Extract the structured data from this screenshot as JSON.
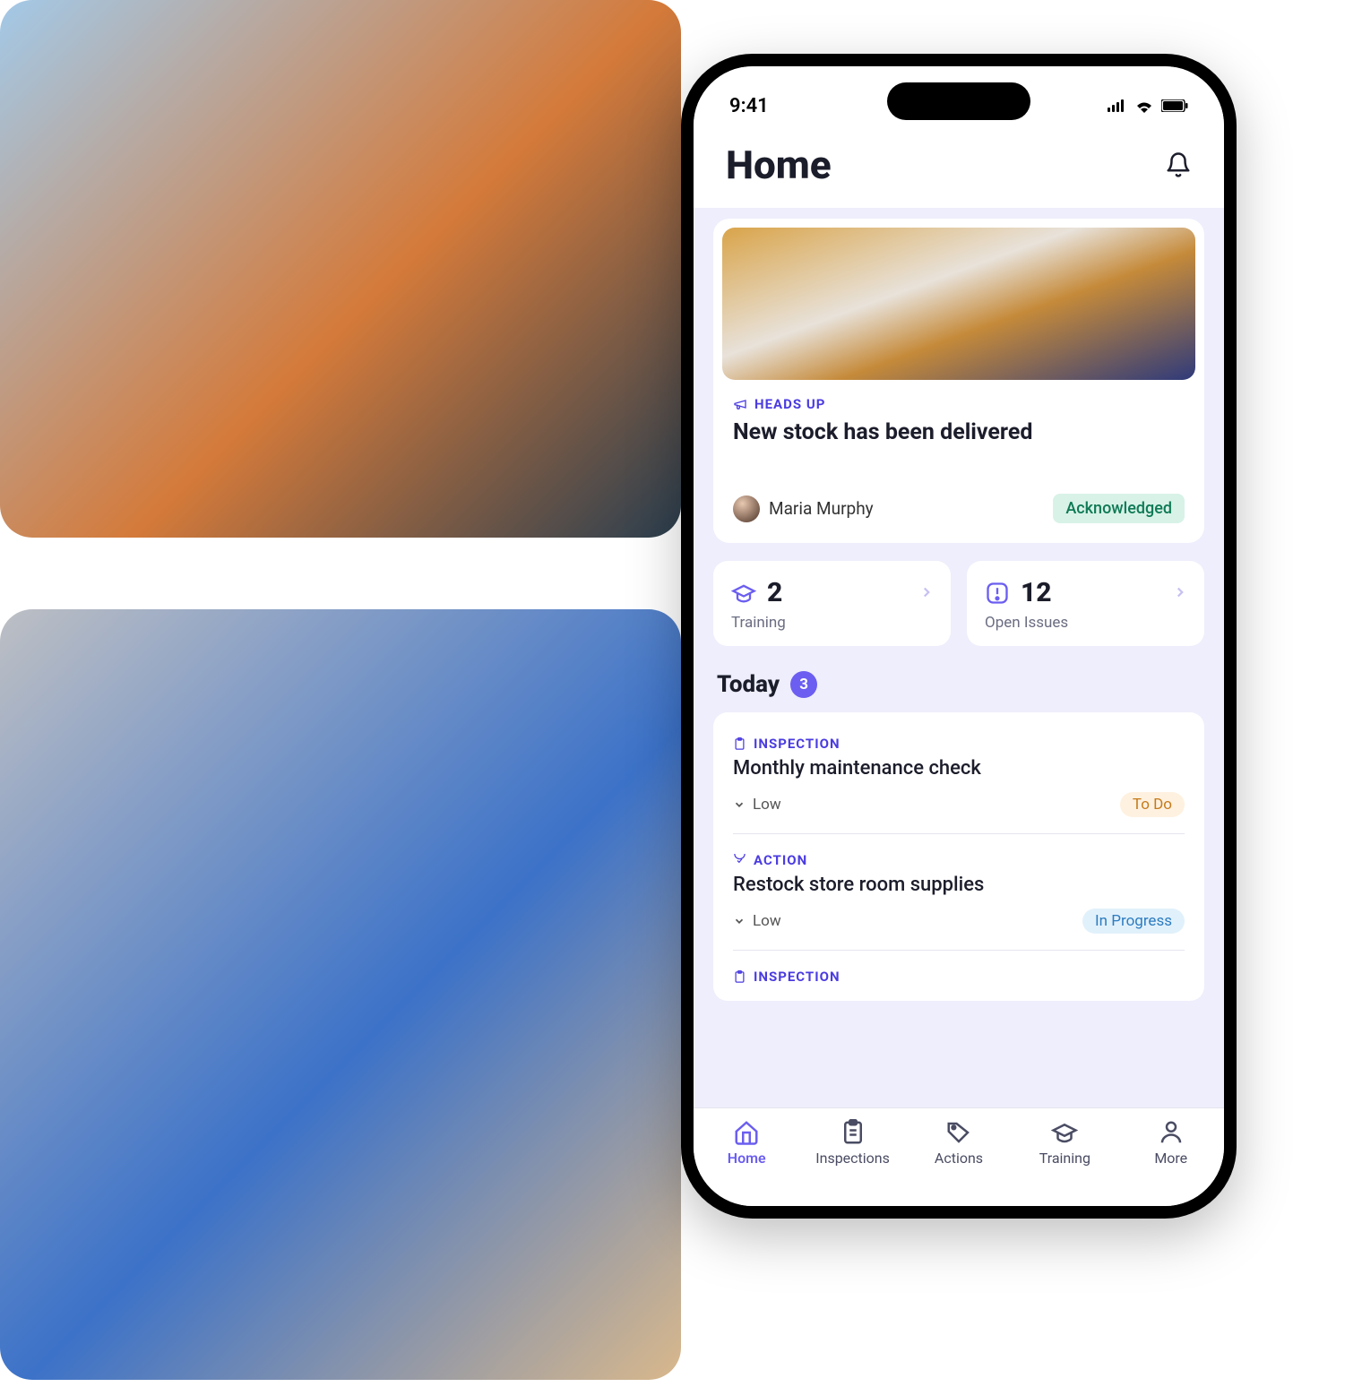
{
  "status": {
    "time": "9:41"
  },
  "header": {
    "title": "Home"
  },
  "headsUp": {
    "eyebrow": "HEADS UP",
    "title": "New stock has been delivered",
    "author": "Maria Murphy",
    "ackLabel": "Acknowledged"
  },
  "stats": {
    "training": {
      "count": "2",
      "label": "Training"
    },
    "issues": {
      "count": "12",
      "label": "Open Issues"
    }
  },
  "today": {
    "label": "Today",
    "count": "3"
  },
  "tasks": [
    {
      "type": "INSPECTION",
      "title": "Monthly maintenance check",
      "priority": "Low",
      "status": "To Do",
      "statusClass": "chip-todo"
    },
    {
      "type": "ACTION",
      "title": "Restock store room supplies",
      "priority": "Low",
      "status": "In Progress",
      "statusClass": "chip-progress"
    },
    {
      "type": "INSPECTION",
      "title": "",
      "priority": "",
      "status": "",
      "statusClass": ""
    }
  ],
  "tabs": {
    "home": "Home",
    "inspections": "Inspections",
    "actions": "Actions",
    "training": "Training",
    "more": "More"
  }
}
